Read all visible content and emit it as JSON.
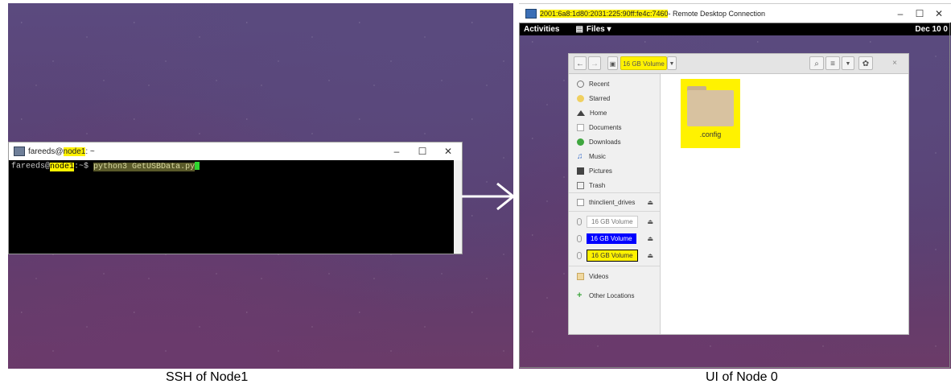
{
  "left": {
    "terminal": {
      "title_user": "fareeds@",
      "title_host": "node1",
      "title_rest": ": ~",
      "prompt_user": "fareeds@",
      "prompt_host": "node1",
      "prompt_rest": ":~$ ",
      "command": "python3 GetUSBData.py",
      "controls": {
        "minimize": "–",
        "maximize": "☐",
        "close": "✕"
      }
    },
    "caption": "SSH of Node1"
  },
  "arrow_icon": "right-arrow",
  "right": {
    "rdp": {
      "title_addr": "2001:6a8:1d80:2031:225:90ff:fe4c:7460",
      "title_rest": " - Remote Desktop Connection",
      "controls": {
        "minimize": "–",
        "maximize": "☐",
        "close": "✕"
      }
    },
    "gnome_bar": {
      "activities": "Activities",
      "app_menu": "Files ▾",
      "clock": "Dec 10 0"
    },
    "files": {
      "location": "16 GB Volume",
      "sidebar": {
        "places": [
          "Recent",
          "Starred",
          "Home",
          "Documents",
          "Downloads",
          "Music",
          "Pictures",
          "Trash",
          "thinclient_drives"
        ],
        "volumes": [
          "16 GB Volume",
          "16 GB Volume",
          "16 GB Volume"
        ],
        "videos": "Videos",
        "other": "Other Locations"
      },
      "items": [
        {
          "name": ".config",
          "icon": "folder-icon"
        }
      ]
    },
    "caption": "UI of Node 0"
  },
  "colors": {
    "highlight": "#fff200",
    "selected": "#0000ff",
    "terminal_bg": "#000000"
  }
}
